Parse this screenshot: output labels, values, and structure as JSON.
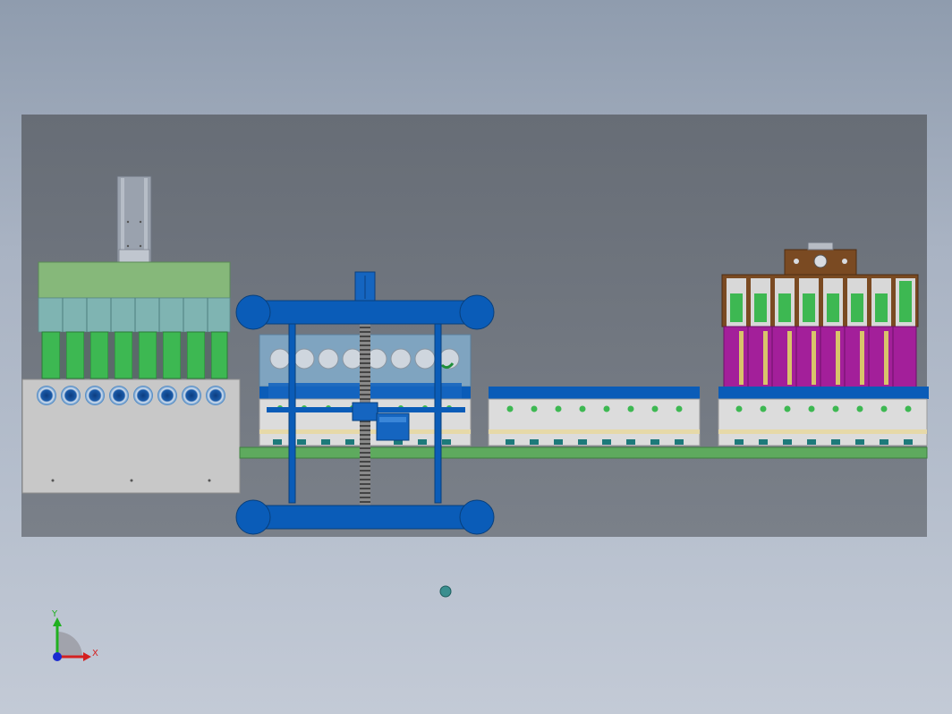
{
  "viewport": {
    "background_top": "#8f9cae",
    "background_bottom": "#c3cad6"
  },
  "triad": {
    "x_label": "X",
    "y_label": "Y",
    "x_color": "#d42020",
    "y_color": "#20b020",
    "z_color": "#1a2ad0"
  },
  "colors": {
    "frame_blue": "#0a5cb8",
    "conveyor_green": "#5eaa5e",
    "panel_gray": "#c8c8c8",
    "cassette_green": "#39b54a",
    "cassette_magenta": "#a31f9a",
    "bracket_brown": "#7a4a22",
    "top_green": "#86b87a"
  }
}
